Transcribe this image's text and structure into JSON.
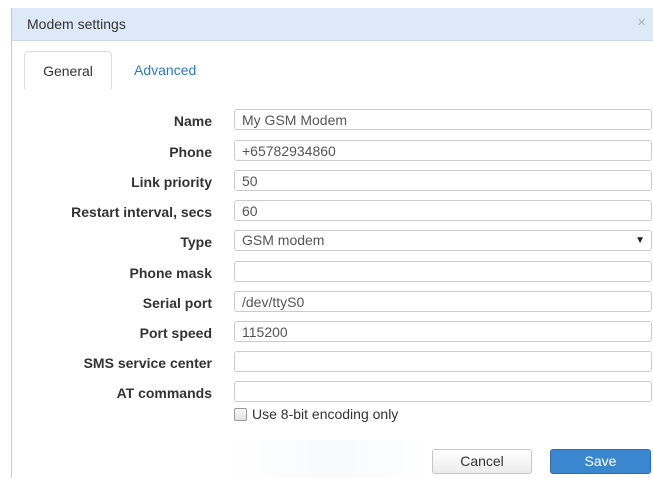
{
  "dialog": {
    "title": "Modem settings",
    "close_glyph": "×"
  },
  "tabs": [
    {
      "label": "General",
      "active": true
    },
    {
      "label": "Advanced",
      "active": false
    }
  ],
  "form": {
    "name": {
      "label": "Name",
      "value": "My GSM Modem"
    },
    "phone": {
      "label": "Phone",
      "value": "+65782934860"
    },
    "link_priority": {
      "label": "Link priority",
      "value": "50"
    },
    "restart_interval": {
      "label": "Restart interval, secs",
      "value": "60"
    },
    "type": {
      "label": "Type",
      "value": "GSM modem"
    },
    "phone_mask": {
      "label": "Phone mask",
      "value": ""
    },
    "serial_port": {
      "label": "Serial port",
      "value": "/dev/ttyS0"
    },
    "port_speed": {
      "label": "Port speed",
      "value": "115200"
    },
    "sms_service_center": {
      "label": "SMS service center",
      "value": ""
    },
    "at_commands": {
      "label": "AT commands",
      "value": ""
    },
    "eight_bit": {
      "label": "Use 8-bit encoding only",
      "checked": false
    }
  },
  "buttons": {
    "cancel": "Cancel",
    "save": "Save"
  },
  "colors": {
    "titlebar": "#dde9f6",
    "accent": "#3a87d0",
    "link": "#2a7ac4"
  },
  "icons": {
    "close": "close-icon",
    "dropdown": "chevron-down-icon"
  }
}
